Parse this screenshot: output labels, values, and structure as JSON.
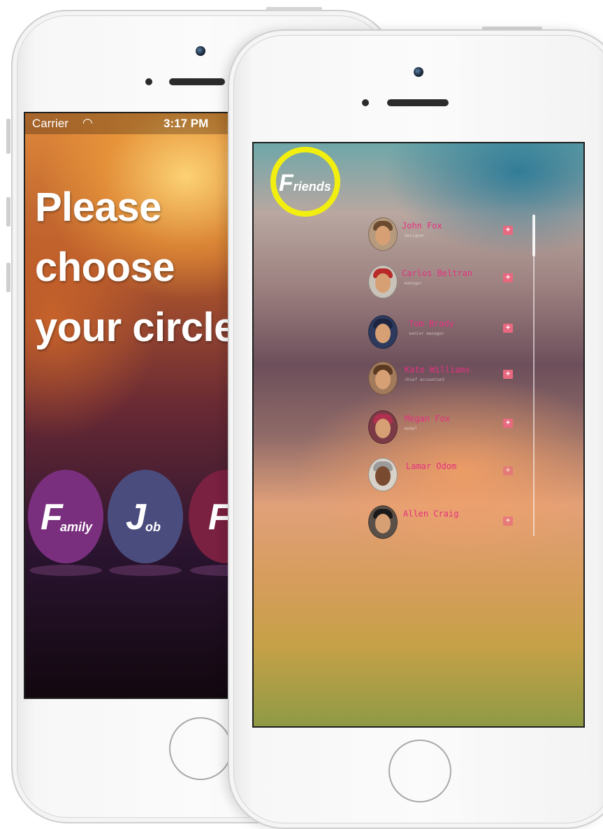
{
  "back_screen": {
    "status_bar": {
      "carrier": "Carrier",
      "time": "3:17 PM",
      "wifi_icon": "wifi-icon"
    },
    "headline": [
      "Please",
      "choose",
      "your circle"
    ],
    "circles": [
      {
        "initial": "F",
        "rest": "amily",
        "color": "#7a2f7e"
      },
      {
        "initial": "J",
        "rest": "ob",
        "color": "#4a4c7d"
      },
      {
        "initial": "F",
        "rest": "",
        "color": "#7a2040"
      }
    ]
  },
  "front_screen": {
    "title": {
      "initial": "F",
      "rest": "riends",
      "ring_color": "#f2ef10"
    },
    "friends": [
      {
        "name": "John Fox",
        "role": "designer",
        "add_label": "+"
      },
      {
        "name": "Carlos Beltran",
        "role": "manager",
        "add_label": "+"
      },
      {
        "name": "Tom Brady",
        "role": "senior manager",
        "add_label": "+"
      },
      {
        "name": "Kate Williams",
        "role": "chief accountant",
        "add_label": "+"
      },
      {
        "name": "Megan Fox",
        "role": "model",
        "add_label": "+"
      },
      {
        "name": "Lamar Odom",
        "role": "",
        "add_label": "+"
      },
      {
        "name": "Allen Craig",
        "role": "",
        "add_label": "+"
      }
    ],
    "accent_name_color": "#e4317f",
    "add_button_color": "#e8697f"
  }
}
